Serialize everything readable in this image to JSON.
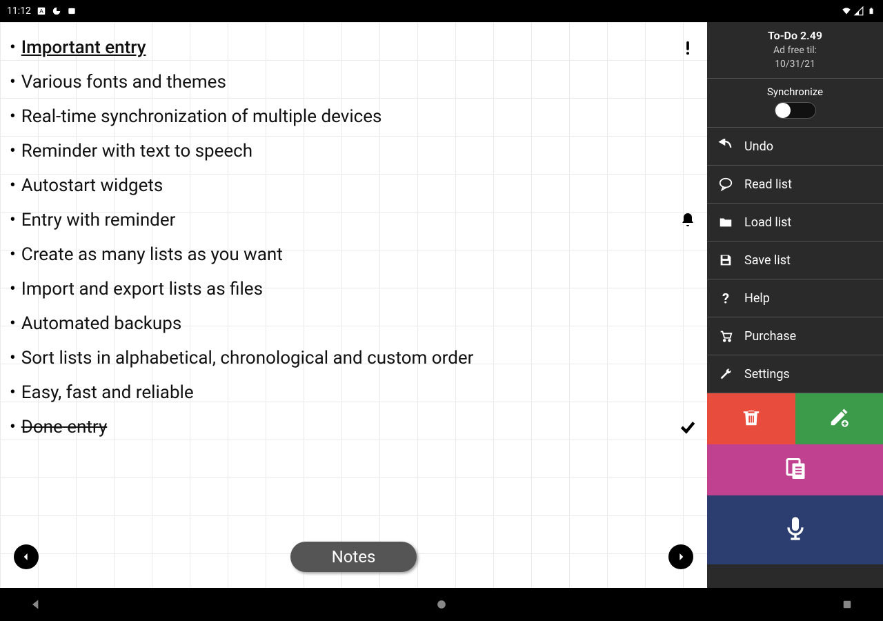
{
  "status": {
    "time": "11:12"
  },
  "list": {
    "items": [
      {
        "text": "Important entry",
        "important": true,
        "icon": "exclaim"
      },
      {
        "text": "Various fonts and themes"
      },
      {
        "text": "Real-time synchronization of multiple devices"
      },
      {
        "text": "Reminder with text to speech"
      },
      {
        "text": "Autostart widgets"
      },
      {
        "text": "Entry with reminder",
        "icon": "bell"
      },
      {
        "text": "Create as many lists as you want"
      },
      {
        "text": "Import and export lists as files"
      },
      {
        "text": "Automated backups"
      },
      {
        "text": "Sort lists in alphabetical, chronological and custom order"
      },
      {
        "text": "Easy, fast and reliable"
      },
      {
        "text": "Done entry",
        "done": true,
        "icon": "check"
      }
    ]
  },
  "bottom": {
    "notes_label": "Notes"
  },
  "sidebar": {
    "app_title": "To-Do 2.49",
    "ad_free_label": "Ad free til:",
    "ad_free_date": "10/31/21",
    "sync_label": "Synchronize",
    "menu": {
      "undo": "Undo",
      "read_list": "Read list",
      "load_list": "Load list",
      "save_list": "Save list",
      "help": "Help",
      "purchase": "Purchase",
      "settings": "Settings"
    }
  }
}
